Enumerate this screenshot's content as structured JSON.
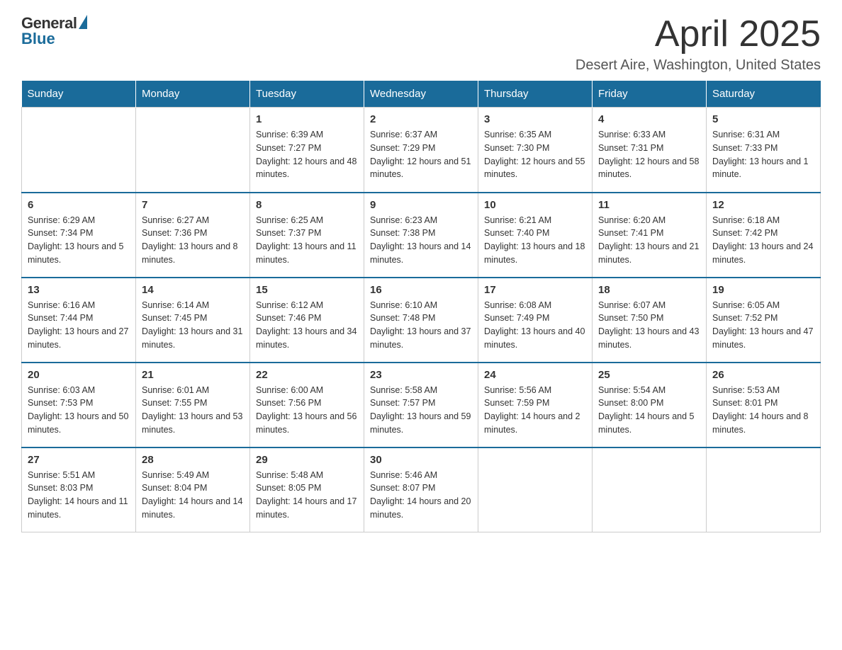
{
  "header": {
    "logo_general": "General",
    "logo_blue": "Blue",
    "month_title": "April 2025",
    "location": "Desert Aire, Washington, United States"
  },
  "weekdays": [
    "Sunday",
    "Monday",
    "Tuesday",
    "Wednesday",
    "Thursday",
    "Friday",
    "Saturday"
  ],
  "weeks": [
    [
      {
        "day": "",
        "sunrise": "",
        "sunset": "",
        "daylight": ""
      },
      {
        "day": "",
        "sunrise": "",
        "sunset": "",
        "daylight": ""
      },
      {
        "day": "1",
        "sunrise": "Sunrise: 6:39 AM",
        "sunset": "Sunset: 7:27 PM",
        "daylight": "Daylight: 12 hours and 48 minutes."
      },
      {
        "day": "2",
        "sunrise": "Sunrise: 6:37 AM",
        "sunset": "Sunset: 7:29 PM",
        "daylight": "Daylight: 12 hours and 51 minutes."
      },
      {
        "day": "3",
        "sunrise": "Sunrise: 6:35 AM",
        "sunset": "Sunset: 7:30 PM",
        "daylight": "Daylight: 12 hours and 55 minutes."
      },
      {
        "day": "4",
        "sunrise": "Sunrise: 6:33 AM",
        "sunset": "Sunset: 7:31 PM",
        "daylight": "Daylight: 12 hours and 58 minutes."
      },
      {
        "day": "5",
        "sunrise": "Sunrise: 6:31 AM",
        "sunset": "Sunset: 7:33 PM",
        "daylight": "Daylight: 13 hours and 1 minute."
      }
    ],
    [
      {
        "day": "6",
        "sunrise": "Sunrise: 6:29 AM",
        "sunset": "Sunset: 7:34 PM",
        "daylight": "Daylight: 13 hours and 5 minutes."
      },
      {
        "day": "7",
        "sunrise": "Sunrise: 6:27 AM",
        "sunset": "Sunset: 7:36 PM",
        "daylight": "Daylight: 13 hours and 8 minutes."
      },
      {
        "day": "8",
        "sunrise": "Sunrise: 6:25 AM",
        "sunset": "Sunset: 7:37 PM",
        "daylight": "Daylight: 13 hours and 11 minutes."
      },
      {
        "day": "9",
        "sunrise": "Sunrise: 6:23 AM",
        "sunset": "Sunset: 7:38 PM",
        "daylight": "Daylight: 13 hours and 14 minutes."
      },
      {
        "day": "10",
        "sunrise": "Sunrise: 6:21 AM",
        "sunset": "Sunset: 7:40 PM",
        "daylight": "Daylight: 13 hours and 18 minutes."
      },
      {
        "day": "11",
        "sunrise": "Sunrise: 6:20 AM",
        "sunset": "Sunset: 7:41 PM",
        "daylight": "Daylight: 13 hours and 21 minutes."
      },
      {
        "day": "12",
        "sunrise": "Sunrise: 6:18 AM",
        "sunset": "Sunset: 7:42 PM",
        "daylight": "Daylight: 13 hours and 24 minutes."
      }
    ],
    [
      {
        "day": "13",
        "sunrise": "Sunrise: 6:16 AM",
        "sunset": "Sunset: 7:44 PM",
        "daylight": "Daylight: 13 hours and 27 minutes."
      },
      {
        "day": "14",
        "sunrise": "Sunrise: 6:14 AM",
        "sunset": "Sunset: 7:45 PM",
        "daylight": "Daylight: 13 hours and 31 minutes."
      },
      {
        "day": "15",
        "sunrise": "Sunrise: 6:12 AM",
        "sunset": "Sunset: 7:46 PM",
        "daylight": "Daylight: 13 hours and 34 minutes."
      },
      {
        "day": "16",
        "sunrise": "Sunrise: 6:10 AM",
        "sunset": "Sunset: 7:48 PM",
        "daylight": "Daylight: 13 hours and 37 minutes."
      },
      {
        "day": "17",
        "sunrise": "Sunrise: 6:08 AM",
        "sunset": "Sunset: 7:49 PM",
        "daylight": "Daylight: 13 hours and 40 minutes."
      },
      {
        "day": "18",
        "sunrise": "Sunrise: 6:07 AM",
        "sunset": "Sunset: 7:50 PM",
        "daylight": "Daylight: 13 hours and 43 minutes."
      },
      {
        "day": "19",
        "sunrise": "Sunrise: 6:05 AM",
        "sunset": "Sunset: 7:52 PM",
        "daylight": "Daylight: 13 hours and 47 minutes."
      }
    ],
    [
      {
        "day": "20",
        "sunrise": "Sunrise: 6:03 AM",
        "sunset": "Sunset: 7:53 PM",
        "daylight": "Daylight: 13 hours and 50 minutes."
      },
      {
        "day": "21",
        "sunrise": "Sunrise: 6:01 AM",
        "sunset": "Sunset: 7:55 PM",
        "daylight": "Daylight: 13 hours and 53 minutes."
      },
      {
        "day": "22",
        "sunrise": "Sunrise: 6:00 AM",
        "sunset": "Sunset: 7:56 PM",
        "daylight": "Daylight: 13 hours and 56 minutes."
      },
      {
        "day": "23",
        "sunrise": "Sunrise: 5:58 AM",
        "sunset": "Sunset: 7:57 PM",
        "daylight": "Daylight: 13 hours and 59 minutes."
      },
      {
        "day": "24",
        "sunrise": "Sunrise: 5:56 AM",
        "sunset": "Sunset: 7:59 PM",
        "daylight": "Daylight: 14 hours and 2 minutes."
      },
      {
        "day": "25",
        "sunrise": "Sunrise: 5:54 AM",
        "sunset": "Sunset: 8:00 PM",
        "daylight": "Daylight: 14 hours and 5 minutes."
      },
      {
        "day": "26",
        "sunrise": "Sunrise: 5:53 AM",
        "sunset": "Sunset: 8:01 PM",
        "daylight": "Daylight: 14 hours and 8 minutes."
      }
    ],
    [
      {
        "day": "27",
        "sunrise": "Sunrise: 5:51 AM",
        "sunset": "Sunset: 8:03 PM",
        "daylight": "Daylight: 14 hours and 11 minutes."
      },
      {
        "day": "28",
        "sunrise": "Sunrise: 5:49 AM",
        "sunset": "Sunset: 8:04 PM",
        "daylight": "Daylight: 14 hours and 14 minutes."
      },
      {
        "day": "29",
        "sunrise": "Sunrise: 5:48 AM",
        "sunset": "Sunset: 8:05 PM",
        "daylight": "Daylight: 14 hours and 17 minutes."
      },
      {
        "day": "30",
        "sunrise": "Sunrise: 5:46 AM",
        "sunset": "Sunset: 8:07 PM",
        "daylight": "Daylight: 14 hours and 20 minutes."
      },
      {
        "day": "",
        "sunrise": "",
        "sunset": "",
        "daylight": ""
      },
      {
        "day": "",
        "sunrise": "",
        "sunset": "",
        "daylight": ""
      },
      {
        "day": "",
        "sunrise": "",
        "sunset": "",
        "daylight": ""
      }
    ]
  ]
}
